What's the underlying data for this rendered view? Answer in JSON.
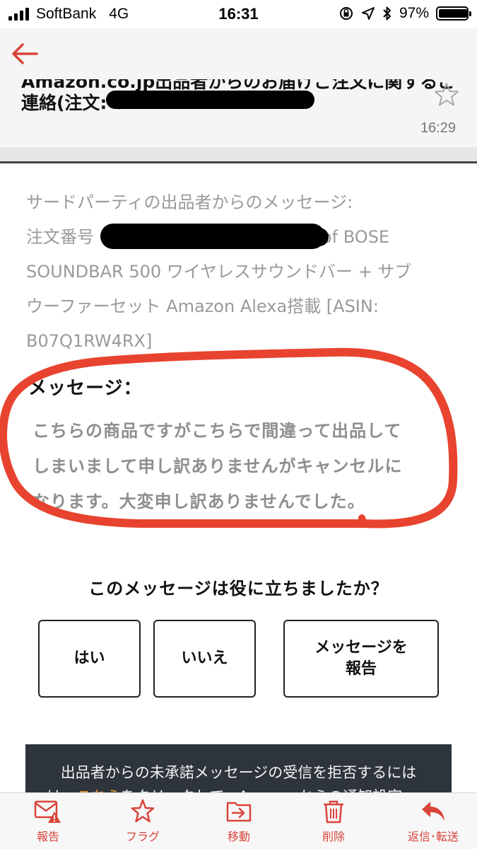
{
  "status_bar": {
    "carrier": "SoftBank",
    "network": "4G",
    "time": "16:31",
    "battery": "97%",
    "signal_bars": 4
  },
  "email": {
    "subject_line_cut": "Amazon.co.jp出品者からのお届けご注文に関するご",
    "subject_line_2": "連絡(注文: 5",
    "time": "16:29"
  },
  "body": {
    "meta_lines": [
      "サードパーティの出品者からのメッセージ:",
      "注文番号",
      "SOUNDBAR 500 ワイヤレスサウンドバー + サブ",
      "ウーファーセット Amazon Alexa搭載 [ASIN:",
      "B07Q1RW4RX]"
    ],
    "meta_line_2_tail": "of BOSE",
    "message_label": "メッセージ：",
    "message_lines": [
      "こちらの商品ですがこちらで間違って出品して",
      "しまいまして申し訳ありませんがキャンセルに",
      "なります。大変申し訳ありませんでした。"
    ]
  },
  "feedback": {
    "question": "このメッセージは役に立ちましたか？",
    "yes": "はい",
    "no": "いいえ",
    "report_line1": "メッセージを",
    "report_line2": "報告"
  },
  "notice": {
    "line1": "出品者からの未承諾メッセージの受信を拒否するには",
    "line2_prefix": "は、",
    "line2_link": "こちら",
    "line2_suffix": "をクリックして、Amazonからの通知設定"
  },
  "toolbar": {
    "items": [
      {
        "label": "報告",
        "icon": "report-spam-icon"
      },
      {
        "label": "フラグ",
        "icon": "flag-star-icon"
      },
      {
        "label": "移動",
        "icon": "move-folder-icon"
      },
      {
        "label": "削除",
        "icon": "trash-icon"
      },
      {
        "label": "返信･転送",
        "icon": "reply-icon"
      }
    ]
  },
  "colors": {
    "accent": "#d9443a",
    "annotation": "#e8432f",
    "notice_bg": "#2d343b",
    "link": "#f0a13a"
  }
}
